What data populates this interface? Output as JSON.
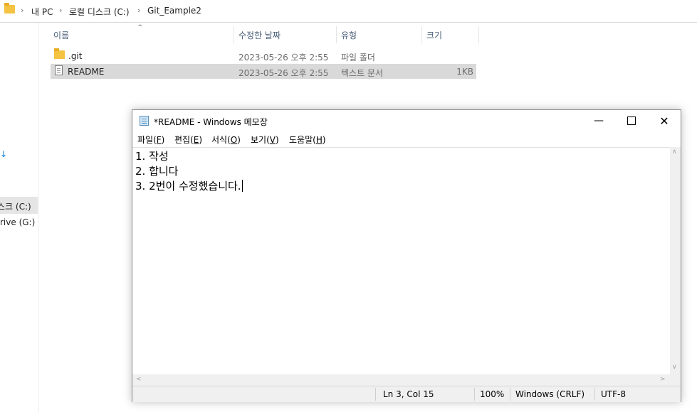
{
  "explorer": {
    "breadcrumb": [
      "내 PC",
      "로컬 디스크 (C:)",
      "Git_Eample2"
    ],
    "nav": {
      "drive_c": "스크 (C:)",
      "drive_g": "rive (G:)",
      "marker": "↓"
    },
    "columns": {
      "name": "이름",
      "modified": "수정한 날짜",
      "type": "유형",
      "size": "크기"
    },
    "files": [
      {
        "name": ".git",
        "modified": "2023-05-26 오후 2:55",
        "type": "파일 폴더",
        "size": "",
        "icon": "folder-icon"
      },
      {
        "name": "README",
        "modified": "2023-05-26 오후 2:55",
        "type": "텍스트 문서",
        "size": "1KB",
        "icon": "text-file-icon",
        "selected": true
      }
    ]
  },
  "notepad": {
    "title": "*README - Windows 메모장",
    "menu": {
      "file": {
        "label": "파일(",
        "key": "F",
        "close": ")"
      },
      "edit": {
        "label": "편집(",
        "key": "E",
        "close": ")"
      },
      "format": {
        "label": "서식(",
        "key": "O",
        "close": ")"
      },
      "view": {
        "label": "보기(",
        "key": "V",
        "close": ")"
      },
      "help": {
        "label": "도움말(",
        "key": "H",
        "close": ")"
      }
    },
    "lines": [
      "1. 작성",
      "2. 합니다",
      "3. 2번이 수정했습니다."
    ],
    "status": {
      "position": "Ln 3, Col 15",
      "zoom": "100%",
      "line_ending": "Windows (CRLF)",
      "encoding": "UTF-8"
    }
  }
}
